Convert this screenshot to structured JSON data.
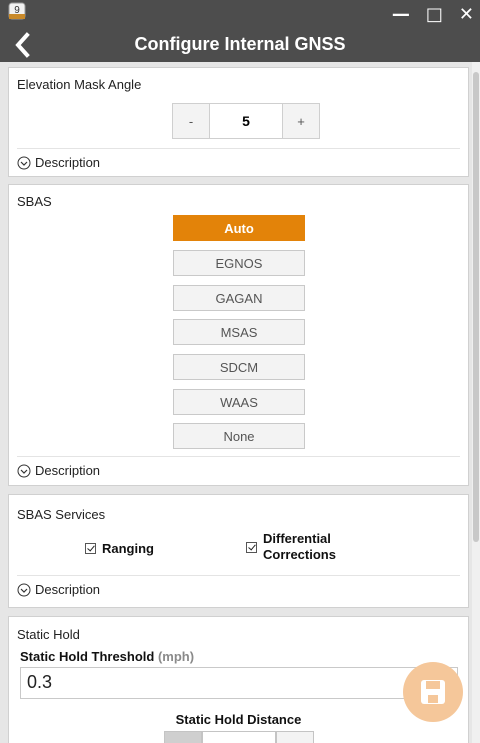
{
  "window": {
    "title": "Configure Internal GNSS",
    "app_icon_label": "9",
    "minimize_glyph": "—",
    "maximize_glyph": "□",
    "close_glyph": "✕"
  },
  "elevation_mask": {
    "title": "Elevation Mask Angle",
    "decrement_label": "-",
    "value": "5",
    "increment_label": "+",
    "description_label": "Description"
  },
  "sbas": {
    "title": "SBAS",
    "options": [
      {
        "label": "Auto",
        "selected": true
      },
      {
        "label": "EGNOS",
        "selected": false
      },
      {
        "label": "GAGAN",
        "selected": false
      },
      {
        "label": "MSAS",
        "selected": false
      },
      {
        "label": "SDCM",
        "selected": false
      },
      {
        "label": "WAAS",
        "selected": false
      },
      {
        "label": "None",
        "selected": false
      }
    ],
    "description_label": "Description"
  },
  "sbas_services": {
    "title": "SBAS Services",
    "ranging_label": "Ranging",
    "ranging_checked": true,
    "differential_label_line1": "Differential",
    "differential_label_line2": "Corrections",
    "differential_checked": true,
    "description_label": "Description"
  },
  "static_hold": {
    "title": "Static Hold",
    "threshold_label": "Static Hold Threshold",
    "threshold_unit": "(mph)",
    "threshold_value": "0.3",
    "distance_label": "Static Hold Distance"
  },
  "colors": {
    "titlebar": "#4d4d4d",
    "accent": "#e38309",
    "fab": "#f5c79a",
    "background": "#e6e6e6"
  },
  "icons": {
    "back": "chevron-left-icon",
    "description": "chevron-circle-down-icon",
    "save": "floppy-disk-icon"
  }
}
